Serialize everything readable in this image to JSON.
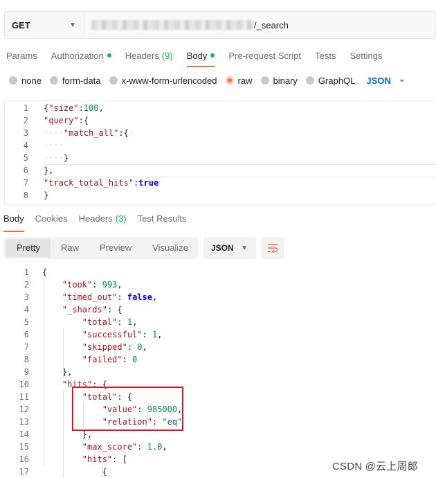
{
  "request": {
    "method": "GET",
    "url_visible_suffix": "/_search"
  },
  "request_tabs": [
    {
      "label": "Params",
      "active": false
    },
    {
      "label": "Authorization",
      "active": false,
      "dot": true
    },
    {
      "label": "Headers",
      "active": false,
      "count": "(9)"
    },
    {
      "label": "Body",
      "active": true,
      "dot": true
    },
    {
      "label": "Pre-request Script",
      "active": false
    },
    {
      "label": "Tests",
      "active": false
    },
    {
      "label": "Settings",
      "active": false
    }
  ],
  "body_types": [
    {
      "label": "none",
      "selected": false
    },
    {
      "label": "form-data",
      "selected": false
    },
    {
      "label": "x-www-form-urlencoded",
      "selected": false
    },
    {
      "label": "raw",
      "selected": true
    },
    {
      "label": "binary",
      "selected": false
    },
    {
      "label": "GraphQL",
      "selected": false
    }
  ],
  "body_language": "JSON",
  "request_body_lines": [
    {
      "n": "1",
      "text": "{\"size\":100,"
    },
    {
      "n": "2",
      "text": "\"query\":{"
    },
    {
      "n": "3",
      "text": "····\"match_all\":{·"
    },
    {
      "n": "4",
      "text": "····"
    },
    {
      "n": "5",
      "text": "····}"
    },
    {
      "n": "6",
      "text": "},"
    },
    {
      "n": "7",
      "text": "\"track_total_hits\":true"
    },
    {
      "n": "8",
      "text": "}"
    }
  ],
  "response_tabs": [
    {
      "label": "Body",
      "active": true
    },
    {
      "label": "Cookies",
      "active": false
    },
    {
      "label": "Headers",
      "active": false,
      "count": "(3)"
    },
    {
      "label": "Test Results",
      "active": false
    }
  ],
  "view_modes": [
    {
      "label": "Pretty",
      "active": true
    },
    {
      "label": "Raw",
      "active": false
    },
    {
      "label": "Preview",
      "active": false
    },
    {
      "label": "Visualize",
      "active": false
    }
  ],
  "response_format": "JSON",
  "response_lines": [
    {
      "n": "1",
      "text": "{"
    },
    {
      "n": "2",
      "text": "    \"took\": 993,"
    },
    {
      "n": "3",
      "text": "    \"timed_out\": false,"
    },
    {
      "n": "4",
      "text": "    \"_shards\": {"
    },
    {
      "n": "5",
      "text": "        \"total\": 1,"
    },
    {
      "n": "6",
      "text": "        \"successful\": 1,"
    },
    {
      "n": "7",
      "text": "        \"skipped\": 0,"
    },
    {
      "n": "8",
      "text": "        \"failed\": 0"
    },
    {
      "n": "9",
      "text": "    },"
    },
    {
      "n": "10",
      "text": "    \"hits\": {"
    },
    {
      "n": "11",
      "text": "        \"total\": {"
    },
    {
      "n": "12",
      "text": "            \"value\": 985000,"
    },
    {
      "n": "13",
      "text": "            \"relation\": \"eq\""
    },
    {
      "n": "14",
      "text": "        },"
    },
    {
      "n": "15",
      "text": "        \"max_score\": 1.0,"
    },
    {
      "n": "16",
      "text": "        \"hits\": ["
    },
    {
      "n": "17",
      "text": "            {"
    }
  ],
  "watermark": "CSDN @云上周郎",
  "colors": {
    "accent": "#f26b3a",
    "status_dot": "#0cbb52",
    "link_blue": "#0265d2",
    "highlight_box": "#e0141e"
  },
  "icons": {
    "method_dropdown": "chevron-down-icon",
    "language_dropdown": "chevron-down-icon",
    "wrap_lines": "wrap-lines-icon"
  }
}
